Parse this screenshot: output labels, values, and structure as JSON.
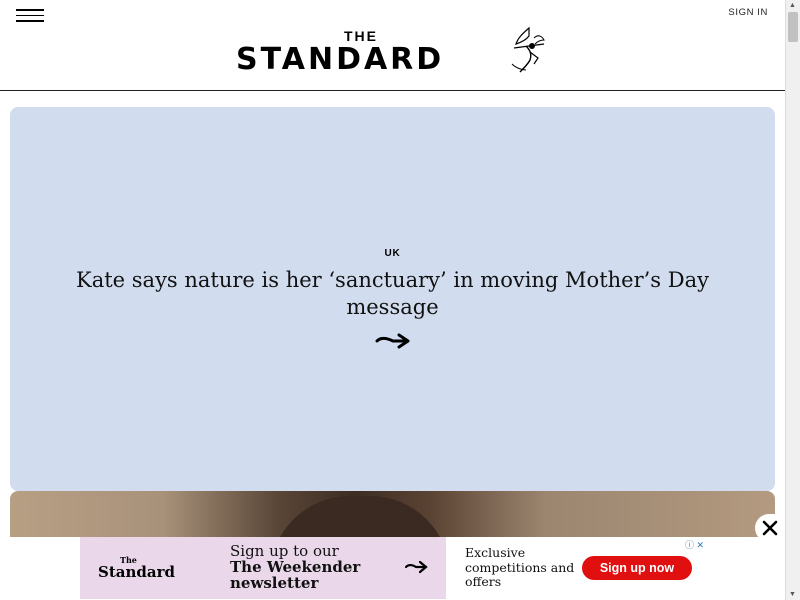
{
  "header": {
    "sign_in": "SIGN IN",
    "logo_the": "THE",
    "logo_standard": "STANDARD"
  },
  "hero": {
    "kicker": "UK",
    "headline": "Kate says nature is her ‘sanctuary’ in moving Mother’s Day message",
    "background": "#d1ddee"
  },
  "ad": {
    "brand_the": "The",
    "brand_name": "Standard",
    "title_line1": "Sign up to our",
    "title_line2": "The Weekender",
    "title_line3": "newsletter",
    "offer_text": "Exclusive competitions and offers",
    "cta_label": "Sign up now",
    "cta_color": "#e00f10",
    "ad_choices": "ⓘ ✕"
  },
  "icons": {
    "menu": "hamburger-icon",
    "close": "close-icon",
    "arrow": "arrow-right-icon"
  }
}
